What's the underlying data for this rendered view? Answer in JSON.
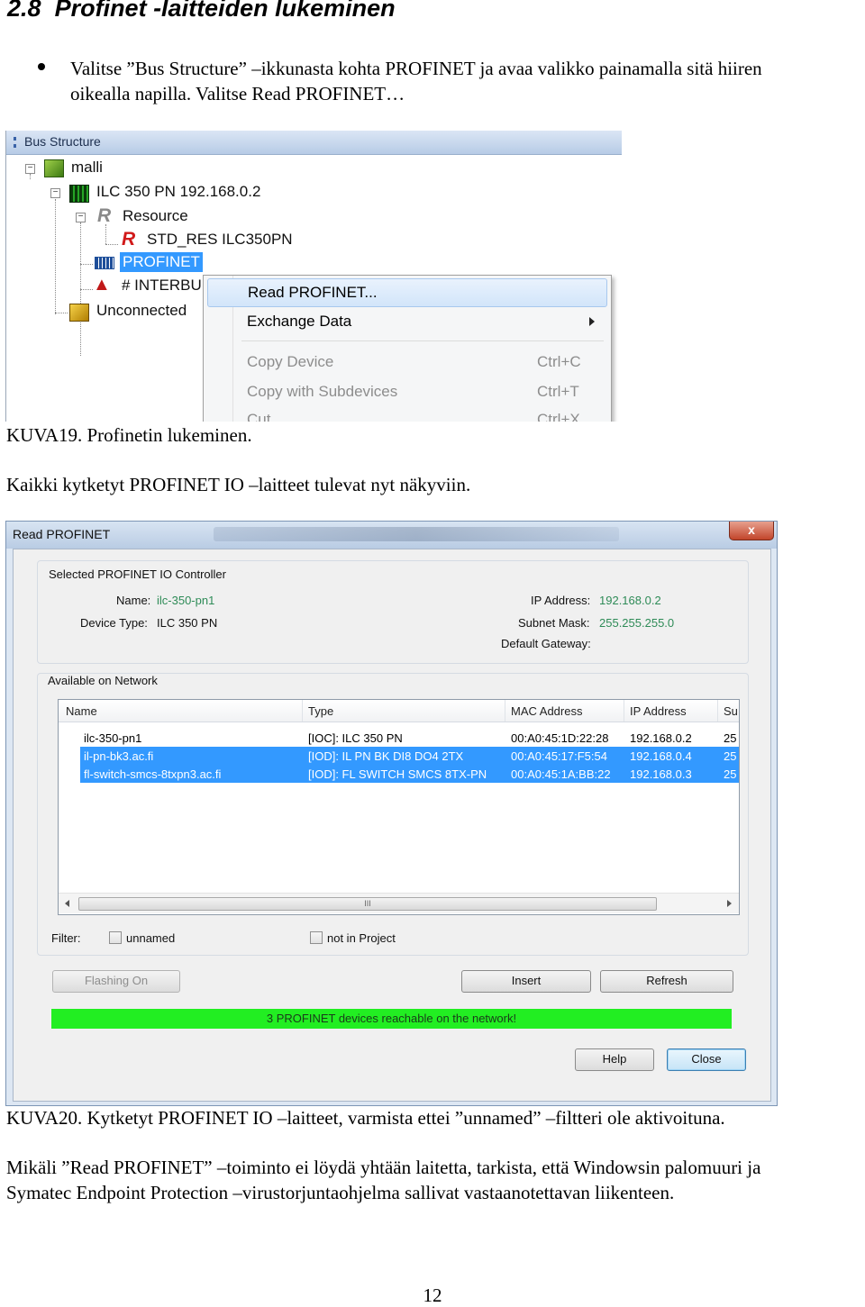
{
  "heading": {
    "number": "2.8",
    "title": "Profinet -laitteiden lukeminen"
  },
  "bullet1": {
    "line1": "Valitse ”Bus Structure” –ikkunasta kohta PROFINET ja avaa valikko painamalla sitä hiiren",
    "line2": "oikealla napilla. Valitse Read PROFINET…"
  },
  "figure1": {
    "window_title": "Bus Structure",
    "tree": {
      "project": "malli",
      "controller": "ILC 350 PN 192.168.0.2",
      "resource": "Resource",
      "std_res": "STD_RES ILC350PN",
      "profinet": "PROFINET",
      "interbus": "# INTERBU",
      "unconnected": "Unconnected"
    },
    "context_menu": {
      "read_profinet": "Read PROFINET...",
      "exchange_data": "Exchange Data",
      "copy_device": "Copy Device",
      "copy_device_shortcut": "Ctrl+C",
      "copy_with_subdevices": "Copy with Subdevices",
      "copy_with_subdevices_shortcut": "Ctrl+T",
      "cut": "Cut",
      "cut_shortcut": "Ctrl+X"
    },
    "caption": "KUVA19. Profinetin lukeminen."
  },
  "para1": "Kaikki kytketyt PROFINET IO –laitteet tulevat nyt näkyviin.",
  "figure2": {
    "window_title": "Read PROFINET",
    "controller_group": {
      "legend": "Selected PROFINET IO Controller",
      "name_label": "Name:",
      "name_value": "ilc-350-pn1",
      "device_type_label": "Device Type:",
      "device_type_value": "ILC 350 PN",
      "ip_label": "IP Address:",
      "ip_value": "192.168.0.2",
      "subnet_label": "Subnet Mask:",
      "subnet_value": "255.255.255.0",
      "gateway_label": "Default Gateway:"
    },
    "network_group": {
      "legend": "Available on Network",
      "columns": [
        "Name",
        "Type",
        "MAC Address",
        "IP Address",
        "Su"
      ],
      "rows": [
        {
          "name": "ilc-350-pn1",
          "type": "[IOC]: ILC 350 PN",
          "mac": "00:A0:45:1D:22:28",
          "ip": "192.168.0.2",
          "su": "25",
          "selected": false
        },
        {
          "name": "il-pn-bk3.ac.fi",
          "type": "[IOD]: IL PN BK DI8 DO4 2TX",
          "mac": "00:A0:45:17:F5:54",
          "ip": "192.168.0.4",
          "su": "25",
          "selected": true
        },
        {
          "name": "fl-switch-smcs-8txpn3.ac.fi",
          "type": "[IOD]: FL SWITCH SMCS 8TX-PN",
          "mac": "00:A0:45:1A:BB:22",
          "ip": "192.168.0.3",
          "su": "25",
          "selected": true
        }
      ],
      "scroll_grip": "III"
    },
    "filter": {
      "label": "Filter:",
      "unnamed": "unnamed",
      "not_in_project": "not in Project"
    },
    "buttons": {
      "flashing_on": "Flashing On",
      "insert": "Insert",
      "refresh": "Refresh",
      "help": "Help",
      "close": "Close"
    },
    "status": "3 PROFINET devices reachable on the network!",
    "close_x": "x",
    "caption": "KUVA20. Kytketyt PROFINET IO –laitteet, varmista ettei ”unnamed” –filtteri ole aktivoituna."
  },
  "para2": {
    "line1": "Mikäli ”Read PROFINET” –toiminto ei löydä yhtään laitetta, tarkista, että Windowsin palomuuri ja",
    "line2": "Symatec Endpoint Protection –virustorjuntaohjelma sallivat vastaanotettavan liikenteen."
  },
  "page_number": "12",
  "colors": {
    "selection": "#3399ff",
    "status_ok": "#22ee22",
    "value_text": "#2e8b57"
  }
}
